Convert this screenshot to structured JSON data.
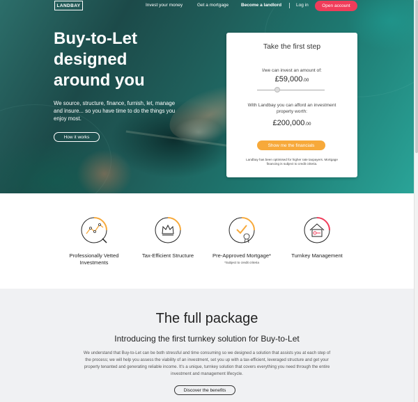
{
  "nav": {
    "logo": "LANDBAY",
    "links": [
      {
        "label": "Invest your money"
      },
      {
        "label": "Get a mortgage"
      },
      {
        "label": "Become a landlord"
      },
      {
        "label": "Log in"
      }
    ],
    "open_account": "Open account"
  },
  "hero": {
    "title_lines": [
      "Buy-to-Let",
      "designed",
      "around you"
    ],
    "subtitle": "We source, structure, finance, furnish, let, manage and insure... so you have time to do the things you enjoy most.",
    "how_button": "How it works"
  },
  "card": {
    "title": "Take the first step",
    "invest_question": "I/we can invest an amount of:",
    "invest_amount": "£59,000",
    "invest_decimals": ".00",
    "slider_fraction": 0.3,
    "property_question": "With Landbay you can afford an investment property worth:",
    "property_amount": "£200,000",
    "property_decimals": ".00",
    "show_button": "Show me the financials",
    "note": "Landbay has been optimised for higher rate taxpayers. Mortgage financing is subject to credit criteria."
  },
  "features": [
    {
      "icon": "vetted-chart-icon",
      "label": "Professionally Vetted Investments",
      "note": ""
    },
    {
      "icon": "crown-icon",
      "label": "Tax-Efficient Structure",
      "note": ""
    },
    {
      "icon": "certificate-check-icon",
      "label": "Pre-Approved Mortgage*",
      "note": "*Subject to credit criteria"
    },
    {
      "icon": "house-key-icon",
      "label": "Turnkey Management",
      "note": ""
    }
  ],
  "package": {
    "title": "The full package",
    "subtitle": "Introducing the first turnkey solution for Buy-to-Let",
    "body": "We understand that Buy-to-Let can be both stressful and time consuming so we designed a solution that assists you at each step of the process; we will help you assess the viability of an investment, set you up with a tax-efficient, leveraged structure and get your property tenanted and generating reliable income. It's a unique, turnkey solution that covers everything you need through the entire investment and management lifecycle.",
    "discover_button": "Discover the benefits"
  },
  "colors": {
    "accent_pink": "#f03c5a",
    "accent_orange": "#f7a93a",
    "hero_teal": "#1f5e5a"
  }
}
